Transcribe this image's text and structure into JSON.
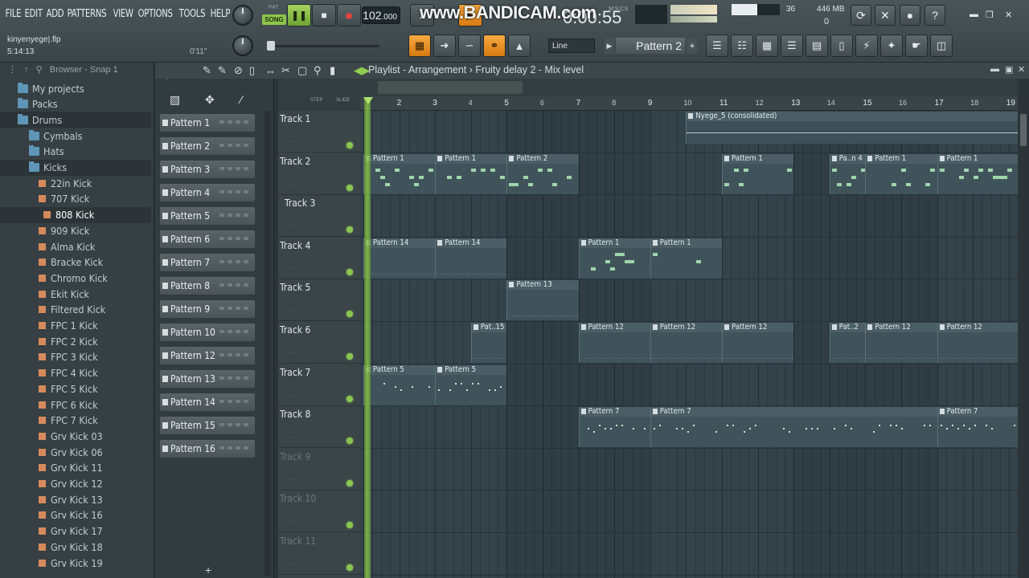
{
  "menu": [
    "FILE",
    "EDIT",
    "ADD",
    "PATTERNS",
    "VIEW",
    "OPTIONS",
    "TOOLS",
    "HELP"
  ],
  "project": {
    "name": "kinyenyege|.flp",
    "time": "5:14:13",
    "hint_time": "0'11\""
  },
  "transport": {
    "pat_label": "PAT",
    "song_label": "SONG",
    "tempo": "102",
    "tempo_frac": ".000",
    "time": "0:00:55",
    "time_unit": "M:S:CS"
  },
  "watermark": "www.BANDICAM.com",
  "monitor": {
    "cpu": "36",
    "memory": "446 MB",
    "polyphony": "0"
  },
  "snap": "Line",
  "current_pattern": "Pattern 2",
  "browser": {
    "title": "Browser - Snap 1",
    "items": [
      {
        "label": "My projects",
        "type": "folder",
        "level": 0
      },
      {
        "label": "Packs",
        "type": "folder",
        "level": 0
      },
      {
        "label": "Drums",
        "type": "folder",
        "level": 1
      },
      {
        "label": "Cymbals",
        "type": "folder",
        "level": 2
      },
      {
        "label": "Hats",
        "type": "folder",
        "level": 2
      },
      {
        "label": "Kicks",
        "type": "folder",
        "level": 2
      },
      {
        "label": "22in Kick",
        "type": "file",
        "level": 3
      },
      {
        "label": "707 Kick",
        "type": "file",
        "level": 3
      },
      {
        "label": "808 Kick",
        "type": "file",
        "level": 3,
        "selected": true
      },
      {
        "label": "909 Kick",
        "type": "file",
        "level": 3
      },
      {
        "label": "Alma Kick",
        "type": "file",
        "level": 3
      },
      {
        "label": "Bracke Kick",
        "type": "file",
        "level": 3
      },
      {
        "label": "Chromo Kick",
        "type": "file",
        "level": 3
      },
      {
        "label": "Ekit Kick",
        "type": "file",
        "level": 3
      },
      {
        "label": "Filtered Kick",
        "type": "file",
        "level": 3
      },
      {
        "label": "FPC 1 Kick",
        "type": "file",
        "level": 3
      },
      {
        "label": "FPC 2 Kick",
        "type": "file",
        "level": 3
      },
      {
        "label": "FPC 3 Kick",
        "type": "file",
        "level": 3
      },
      {
        "label": "FPC 4 Kick",
        "type": "file",
        "level": 3
      },
      {
        "label": "FPC 5 Kick",
        "type": "file",
        "level": 3
      },
      {
        "label": "FPC 6 Kick",
        "type": "file",
        "level": 3
      },
      {
        "label": "FPC 7 Kick",
        "type": "file",
        "level": 3
      },
      {
        "label": "Grv Kick 03",
        "type": "file",
        "level": 3
      },
      {
        "label": "Grv Kick 06",
        "type": "file",
        "level": 3
      },
      {
        "label": "Grv Kick 11",
        "type": "file",
        "level": 3
      },
      {
        "label": "Grv Kick 12",
        "type": "file",
        "level": 3
      },
      {
        "label": "Grv Kick 13",
        "type": "file",
        "level": 3
      },
      {
        "label": "Grv Kick 16",
        "type": "file",
        "level": 3
      },
      {
        "label": "Grv Kick 17",
        "type": "file",
        "level": 3
      },
      {
        "label": "Grv Kick 18",
        "type": "file",
        "level": 3
      },
      {
        "label": "Grv Kick 19",
        "type": "file",
        "level": 3
      }
    ]
  },
  "patterns": [
    "Pattern 1",
    "Pattern 2",
    "Pattern 3",
    "Pattern 4",
    "Pattern 5",
    "Pattern 6",
    "Pattern 7",
    "Pattern 8",
    "Pattern 9",
    "Pattern 10",
    "Pattern 12",
    "Pattern 13",
    "Pattern 14",
    "Pattern 15",
    "Pattern 16"
  ],
  "playlist": {
    "title": "Playlist - Arrangement",
    "subtitle": "Fruity delay 2 - Mix level",
    "ruler_labels": {
      "step": "STEP",
      "slide": "SLIDE"
    },
    "bars": [
      "2",
      "3",
      "4",
      "5",
      "6",
      "7",
      "8",
      "9",
      "10",
      "11",
      "12",
      "13",
      "14",
      "15",
      "16",
      "17",
      "18",
      "19"
    ],
    "tracks": [
      {
        "name": "Track 1",
        "active": true
      },
      {
        "name": "Track 2",
        "active": true
      },
      {
        "name": "Track 3",
        "active": true
      },
      {
        "name": "Track 4",
        "active": true
      },
      {
        "name": "Track 5",
        "active": true
      },
      {
        "name": "Track 6",
        "active": true
      },
      {
        "name": "Track 7",
        "active": true
      },
      {
        "name": "Track 8",
        "active": true
      },
      {
        "name": "Track 9",
        "active": false
      },
      {
        "name": "Track 10",
        "active": false
      },
      {
        "name": "Track 11",
        "active": false
      }
    ],
    "clips": [
      {
        "track": 0,
        "start": 10,
        "len": 9.3,
        "label": "Nyege_5 (consolidated)",
        "kind": "auto"
      },
      {
        "track": 1,
        "start": 1,
        "len": 2,
        "label": "Pattern 1",
        "kind": "notes"
      },
      {
        "track": 1,
        "start": 3,
        "len": 2,
        "label": "Pattern 1",
        "kind": "notes"
      },
      {
        "track": 1,
        "start": 5,
        "len": 2,
        "label": "Pattern 2",
        "kind": "notes"
      },
      {
        "track": 1,
        "start": 11,
        "len": 2,
        "label": "Pattern 1",
        "kind": "notes"
      },
      {
        "track": 1,
        "start": 14,
        "len": 1,
        "label": "Pa..n 4",
        "kind": "notes"
      },
      {
        "track": 1,
        "start": 15,
        "len": 2,
        "label": "Pattern 1",
        "kind": "notes"
      },
      {
        "track": 1,
        "start": 17,
        "len": 2.3,
        "label": "Pattern 1",
        "kind": "notes"
      },
      {
        "track": 3,
        "start": 1,
        "len": 2,
        "label": "Pattern 14",
        "kind": "flat"
      },
      {
        "track": 3,
        "start": 3,
        "len": 2,
        "label": "Pattern 14",
        "kind": "flat"
      },
      {
        "track": 3,
        "start": 7,
        "len": 2,
        "label": "Pattern 1",
        "kind": "notes"
      },
      {
        "track": 3,
        "start": 9,
        "len": 2,
        "label": "Pattern 1",
        "kind": "notes"
      },
      {
        "track": 4,
        "start": 5,
        "len": 2,
        "label": "Pattern 13",
        "kind": "flat"
      },
      {
        "track": 5,
        "start": 4,
        "len": 1,
        "label": "Pat..15",
        "kind": "flat"
      },
      {
        "track": 5,
        "start": 7,
        "len": 2,
        "label": "Pattern 12",
        "kind": "flat"
      },
      {
        "track": 5,
        "start": 9,
        "len": 2,
        "label": "Pattern 12",
        "kind": "flat"
      },
      {
        "track": 5,
        "start": 11,
        "len": 2,
        "label": "Pattern 12",
        "kind": "flat"
      },
      {
        "track": 5,
        "start": 14,
        "len": 1,
        "label": "Pat..2",
        "kind": "flat"
      },
      {
        "track": 5,
        "start": 15,
        "len": 2,
        "label": "Pattern 12",
        "kind": "flat"
      },
      {
        "track": 5,
        "start": 17,
        "len": 2.3,
        "label": "Pattern 12",
        "kind": "flat"
      },
      {
        "track": 6,
        "start": 1,
        "len": 2,
        "label": "Pattern 5",
        "kind": "dots"
      },
      {
        "track": 6,
        "start": 3,
        "len": 2,
        "label": "Pattern 5",
        "kind": "dots"
      },
      {
        "track": 7,
        "start": 7,
        "len": 2,
        "label": "Pattern 7",
        "kind": "dots"
      },
      {
        "track": 7,
        "start": 9,
        "len": 8,
        "label": "Pattern 7",
        "kind": "dots"
      },
      {
        "track": 7,
        "start": 17,
        "len": 2.3,
        "label": "Pattern 7",
        "kind": "dots"
      }
    ]
  }
}
